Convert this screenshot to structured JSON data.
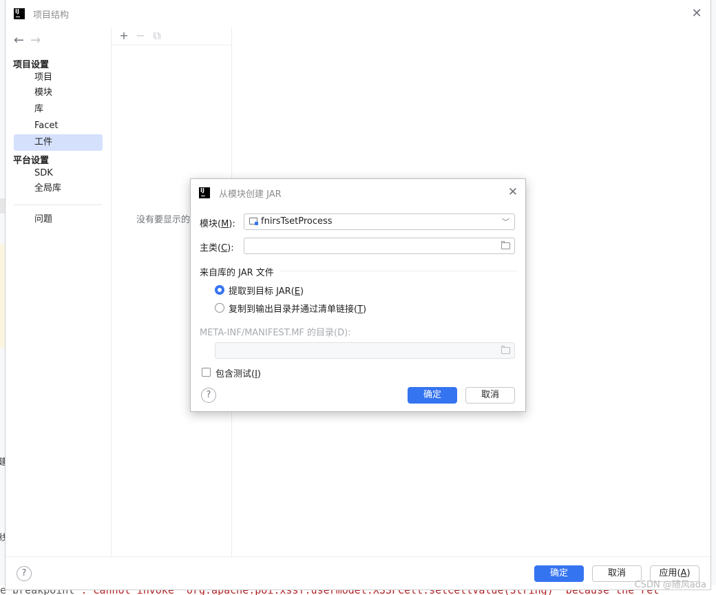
{
  "main_window": {
    "title": "项目结构",
    "sidebar": {
      "section_project": "项目设置",
      "items_project": [
        "项目",
        "模块",
        "库",
        "Facet",
        "工件"
      ],
      "selected": "工件",
      "section_platform": "平台设置",
      "items_platform": [
        "SDK",
        "全局库"
      ],
      "problems": "问题"
    },
    "toolbar": {
      "add": "+",
      "remove": "−",
      "copy": "⧉"
    },
    "empty_text": "没有要显示的",
    "footer": {
      "ok": "确定",
      "cancel": "取消",
      "apply_prefix": "应用(",
      "apply_key": "A",
      "apply_suffix": ")"
    }
  },
  "dialog": {
    "title": "从模块创建 JAR",
    "module_label_prefix": "模块(",
    "module_label_key": "M",
    "module_label_suffix": "):",
    "module_value": "fnirsTsetProcess",
    "main_class_label_prefix": "主类(",
    "main_class_label_key": "C",
    "main_class_label_suffix": "):",
    "main_class_value": "",
    "jar_section_title": "来自库的 JAR 文件",
    "radio_extract_prefix": "提取到目标 JAR(",
    "radio_extract_key": "E",
    "radio_extract_suffix": ")",
    "radio_copy_prefix": "复制到输出目录并通过清单链接(",
    "radio_copy_key": "T",
    "radio_copy_suffix": ")",
    "selected_option": "extract",
    "manifest_label": "META-INF/MANIFEST.MF 的目录(D):",
    "manifest_value": "",
    "include_tests_prefix": "包含测试(",
    "include_tests_key": "I",
    "include_tests_suffix": ")",
    "include_tests_checked": false,
    "ok": "确定",
    "cancel": "取消"
  },
  "background": {
    "code_line_lead": "e breakpoint",
    "code_line": ": Cannot invoke \"org.apache.poi.xssf.usermodel.XSSFCell.setCellValue(String)\" because the ret",
    "left_edge_char_1": "建",
    "left_edge_char_2": "线"
  },
  "watermark": "CSDN @随风ada",
  "colors": {
    "accent": "#3574f0",
    "selection": "#d5e1fc"
  }
}
